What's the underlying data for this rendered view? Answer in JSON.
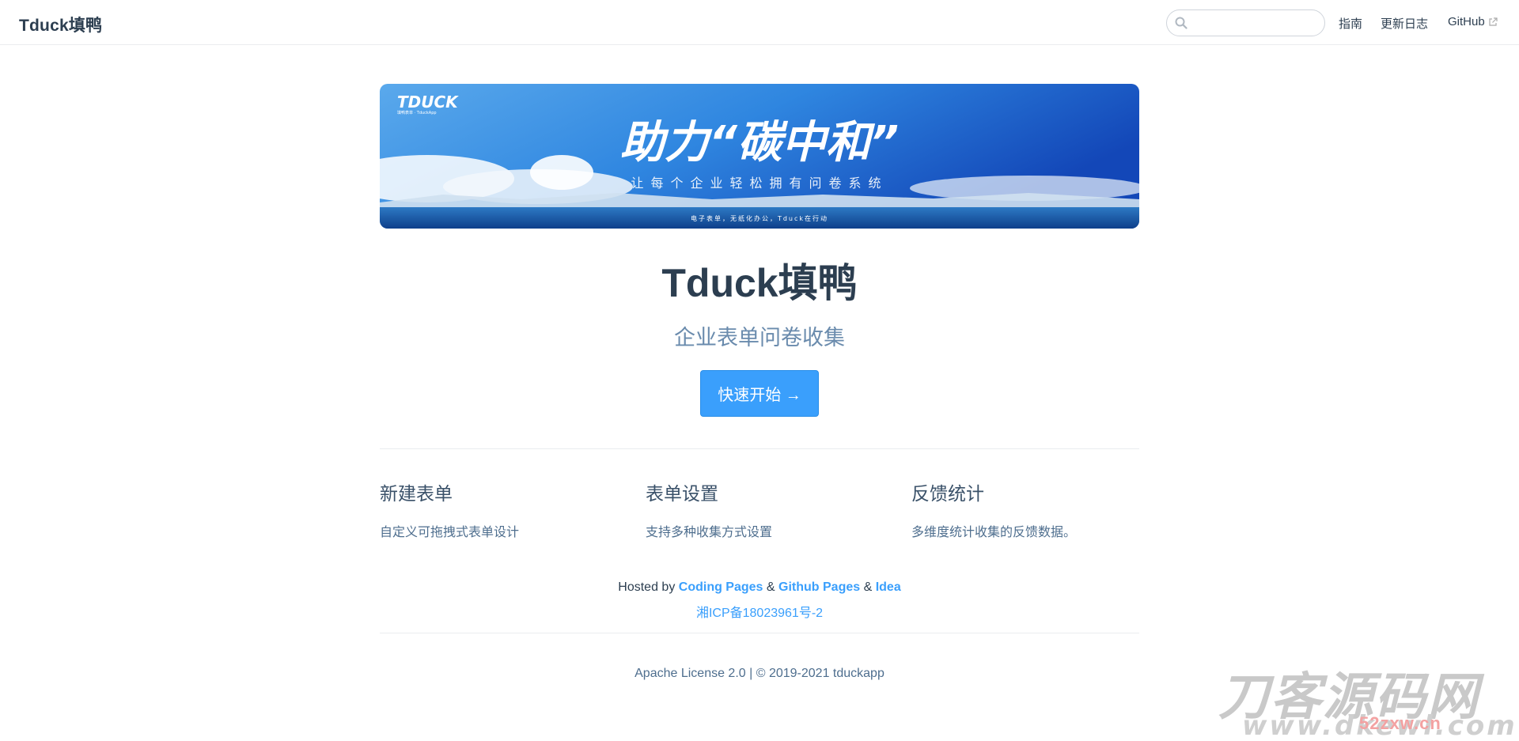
{
  "navbar": {
    "site_name": "Tduck填鸭",
    "search": {
      "value": "",
      "placeholder": ""
    },
    "links": [
      {
        "label": "指南"
      },
      {
        "label": "更新日志"
      },
      {
        "label": "GitHub"
      }
    ]
  },
  "banner": {
    "logo": "TDUCK",
    "logo_sub": "填鸭表单 · TduckApp",
    "headline": "助力“碳中和”",
    "subline": "让每个企业轻松拥有问卷系统",
    "footnote": "电子表单，无纸化办公，Tduck在行动"
  },
  "hero": {
    "title": "Tduck填鸭",
    "description": "企业表单问卷收集",
    "action_label": "快速开始 →"
  },
  "features": [
    {
      "title": "新建表单",
      "details": "自定义可拖拽式表单设计"
    },
    {
      "title": "表单设置",
      "details": "支持多种收集方式设置"
    },
    {
      "title": "反馈统计",
      "details": "多维度统计收集的反馈数据。"
    }
  ],
  "hosted": {
    "prefix": "Hosted by ",
    "link1": "Coding Pages",
    "sep1": " & ",
    "link2": "Github Pages",
    "sep2": " & ",
    "link3": "Idea",
    "icp": "湘ICP备18023961号-2"
  },
  "footer": {
    "text": "Apache License 2.0 | © 2019-2021 tduckapp"
  },
  "watermark": {
    "top": "刀客源码网",
    "bottom": "www.dkewl.com",
    "overlay": "52zxw.cn"
  },
  "colors": {
    "accent": "#3a9ffc",
    "text": "#2c3e50",
    "muted": "#6a8bad"
  }
}
